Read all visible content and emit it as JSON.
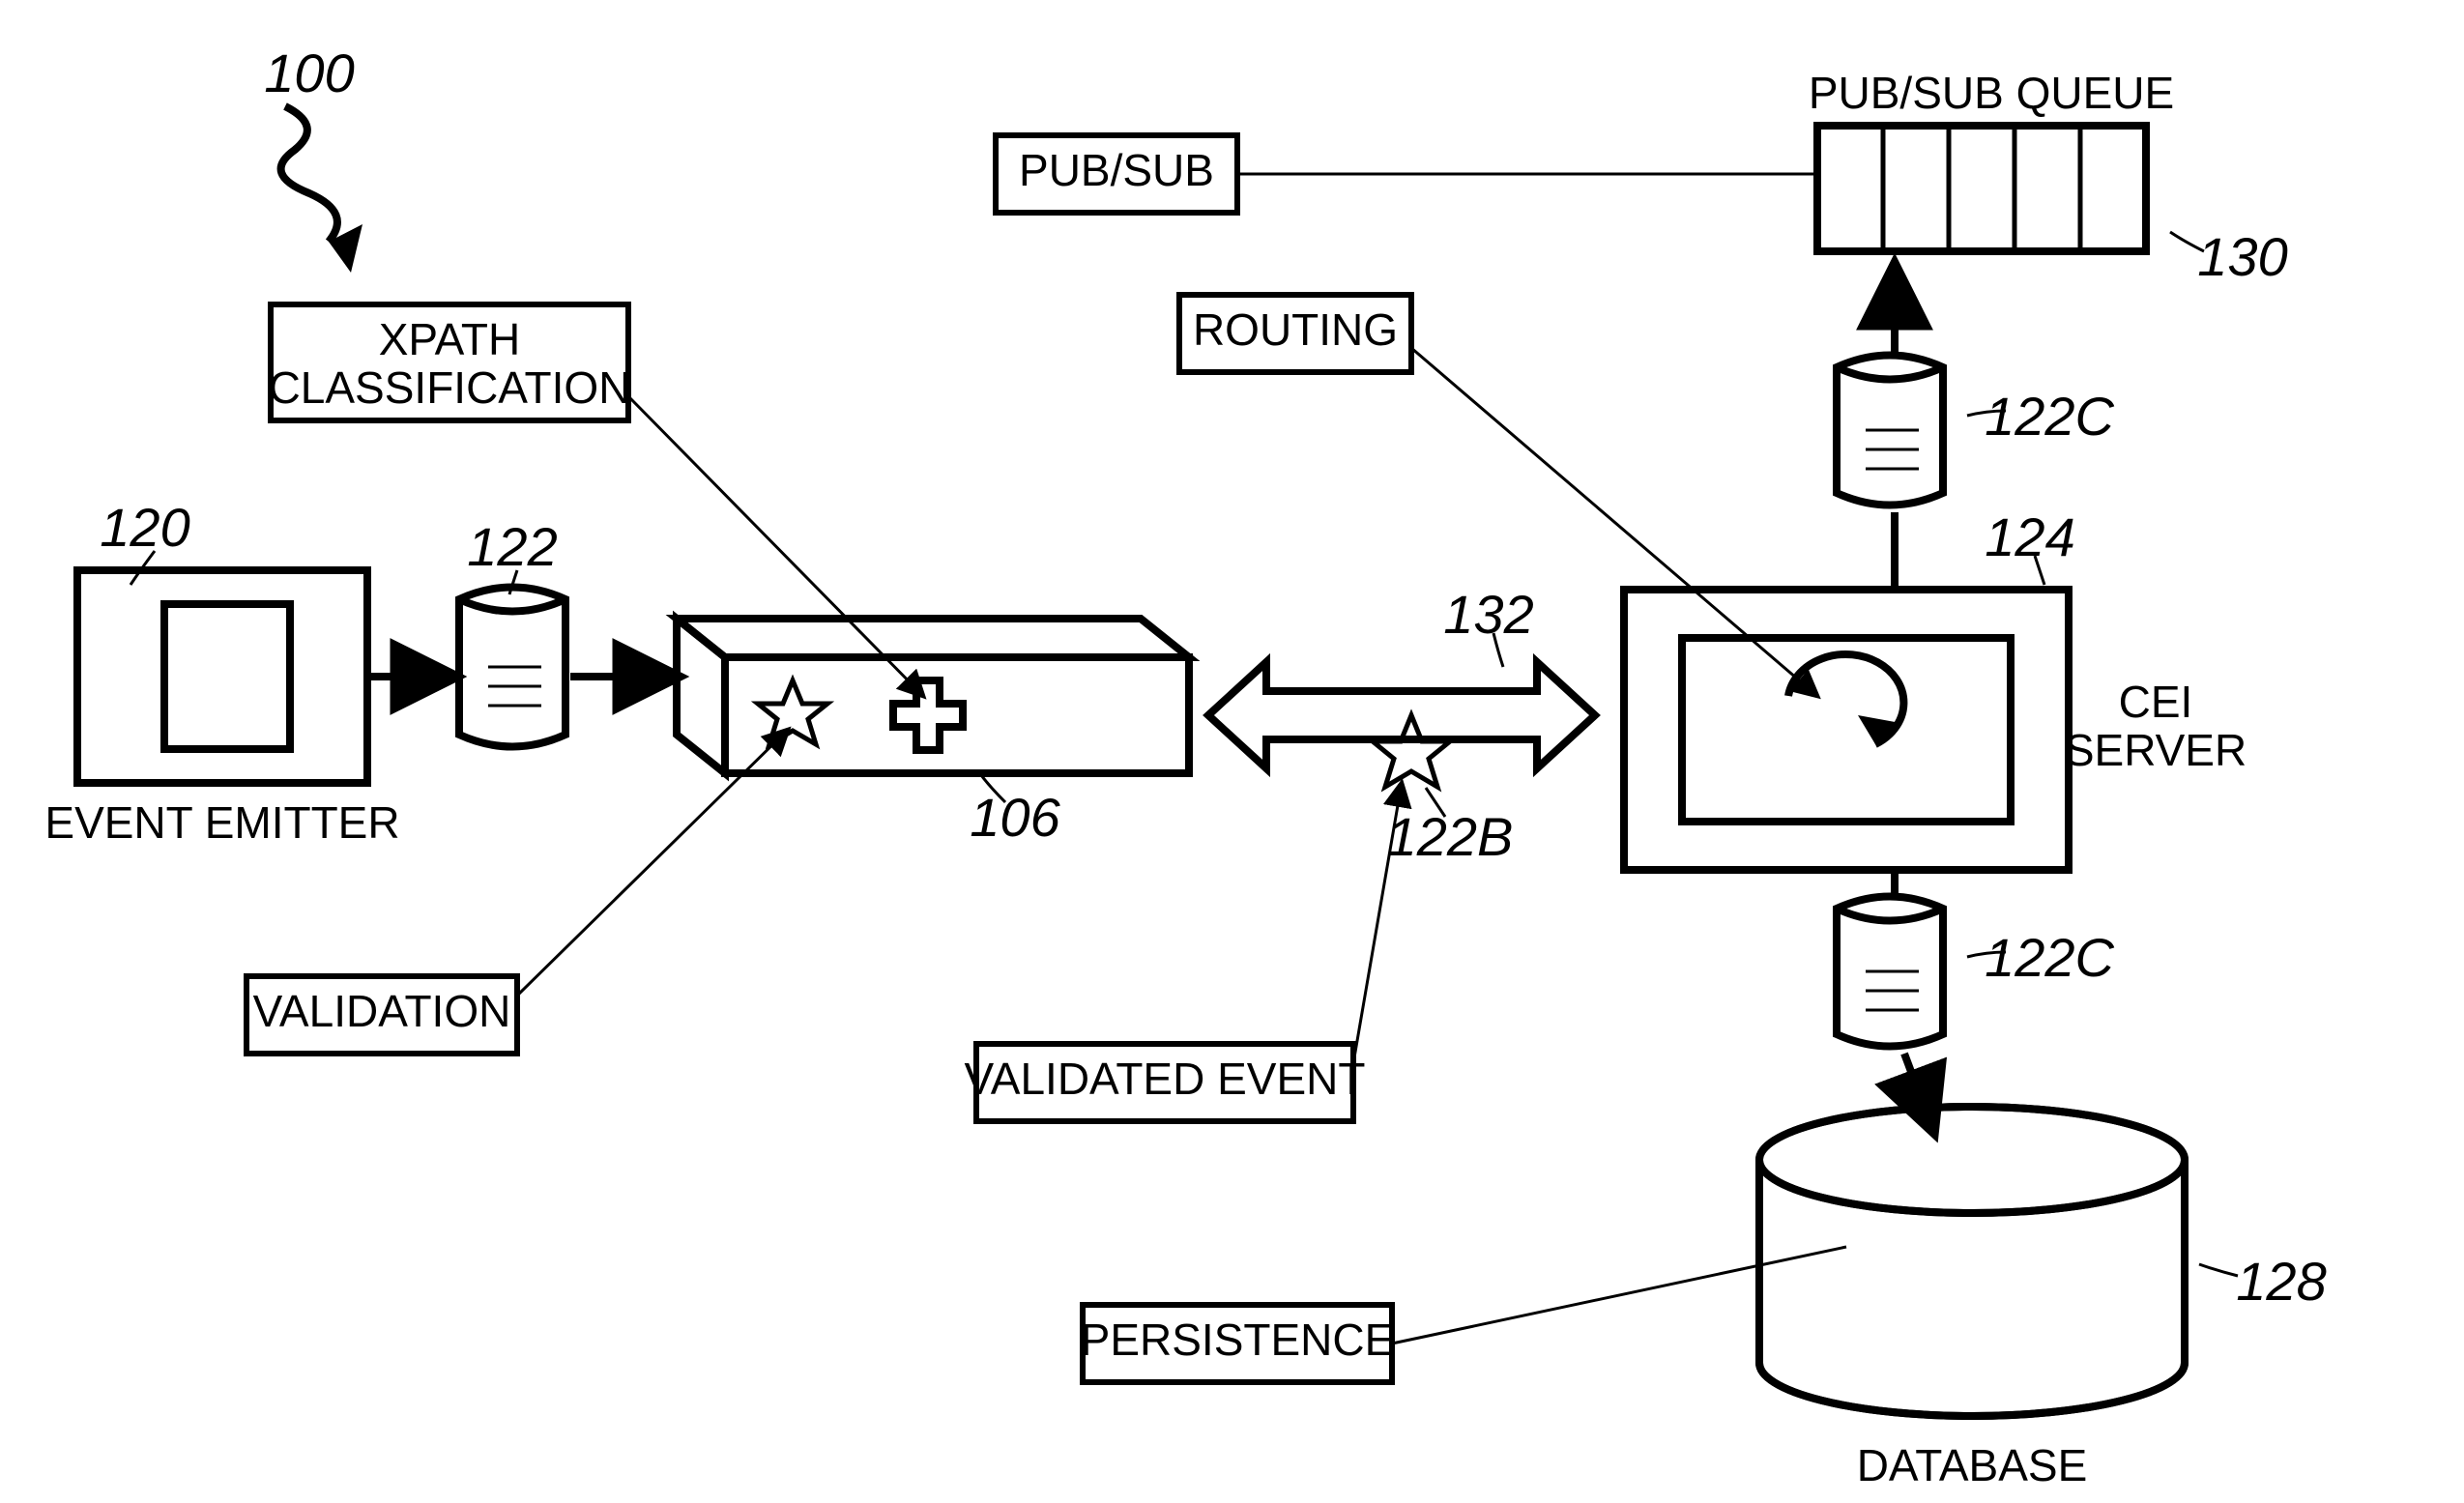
{
  "figure_ref": "100",
  "refs": {
    "emitter": "120",
    "doc1": "122",
    "processor": "106",
    "validated_doc": "122B",
    "arrow_bidir": "132",
    "cei_server": "124",
    "doc_top": "122C",
    "doc_bottom": "122C",
    "queue": "130",
    "database": "128"
  },
  "labels": {
    "event_emitter": "EVENT EMITTER",
    "xpath1": "XPATH",
    "xpath2": "CLASSIFICATION",
    "validation": "VALIDATION",
    "validated_event": "VALIDATED EVENT",
    "routing": "ROUTING",
    "pubsub": "PUB/SUB",
    "pubsub_queue": "PUB/SUB QUEUE",
    "cei1": "CEI",
    "cei2": "SERVER",
    "persistence": "PERSISTENCE",
    "database": "DATABASE"
  }
}
